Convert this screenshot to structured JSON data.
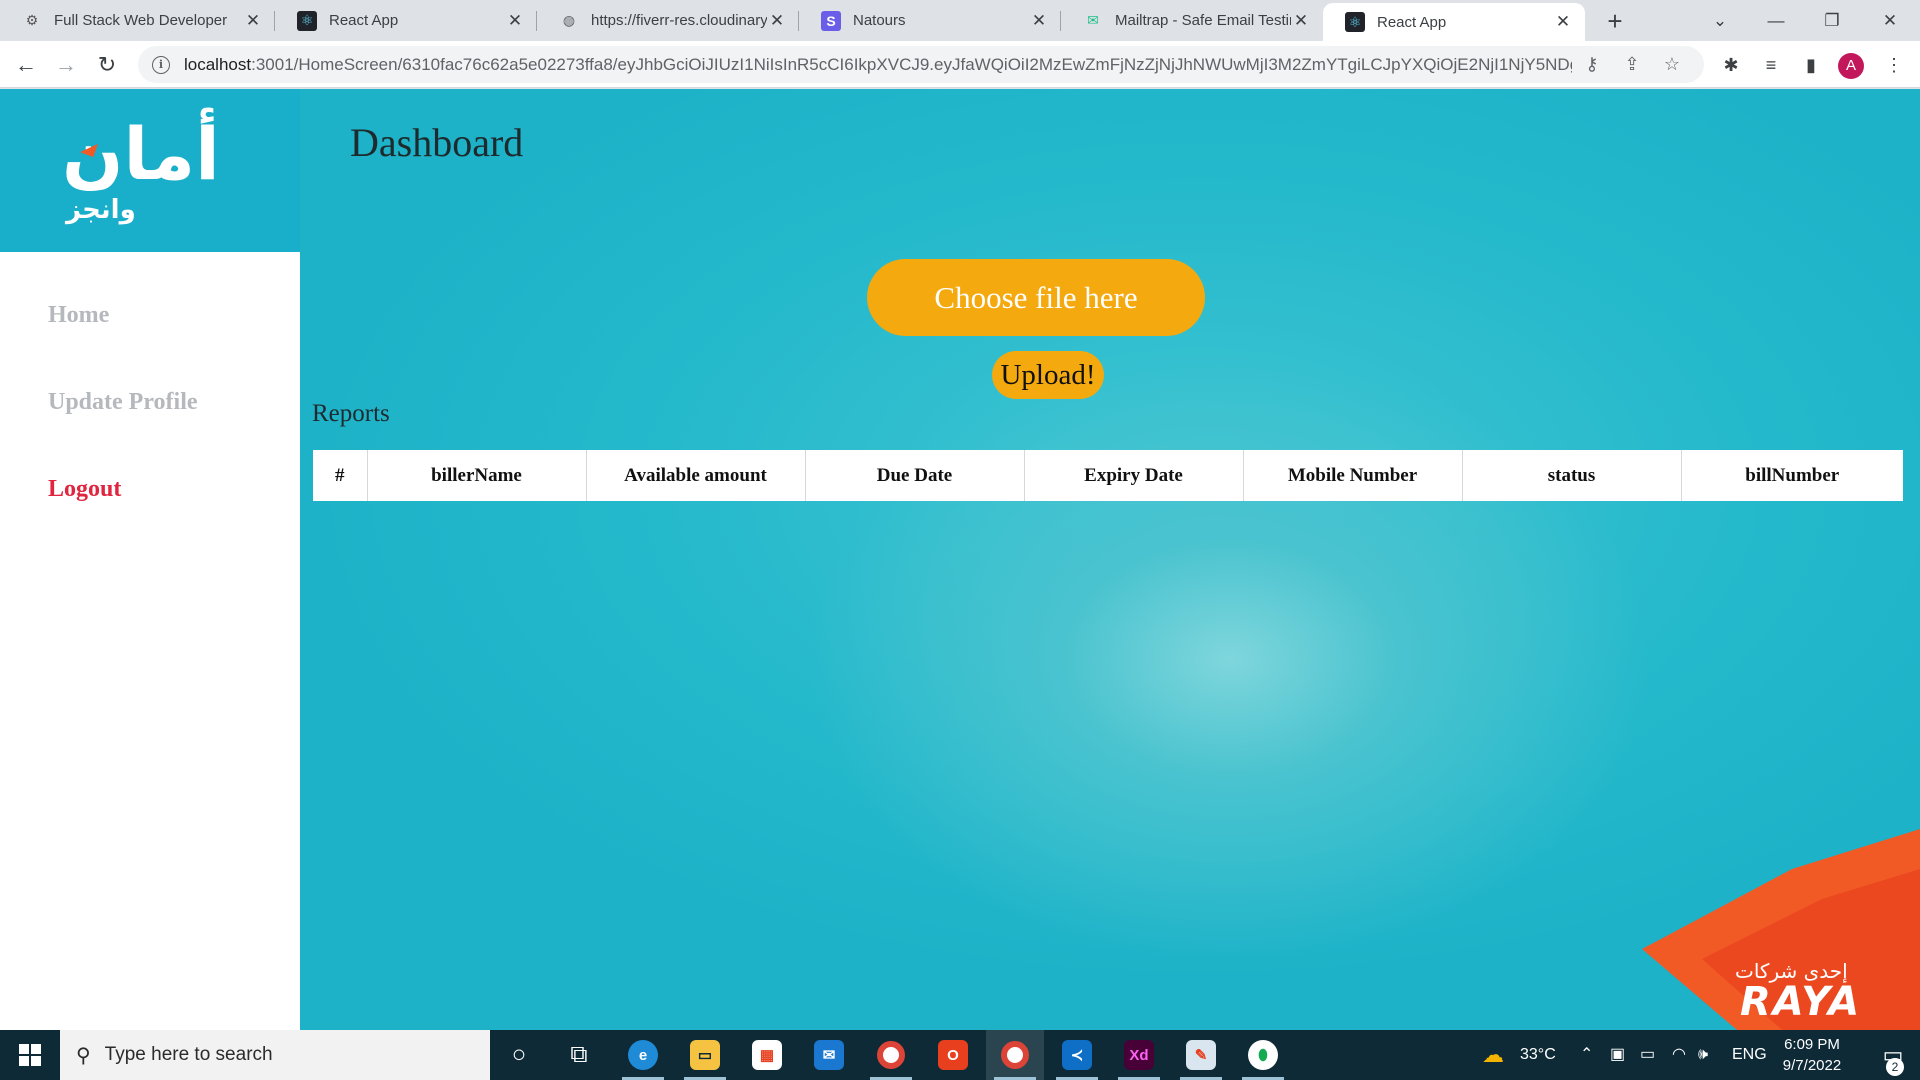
{
  "browser": {
    "tabs": [
      {
        "title": "Full Stack Web Developer",
        "icon": "fiverr-icon"
      },
      {
        "title": "React App",
        "icon": "react-icon"
      },
      {
        "title": "https://fiverr-res.cloudinary",
        "icon": "globe-icon"
      },
      {
        "title": "Natours",
        "icon": "natours-s-icon"
      },
      {
        "title": "Mailtrap - Safe Email Testin",
        "icon": "mailtrap-icon"
      },
      {
        "title": "React App",
        "icon": "react-icon"
      }
    ],
    "active_tab_index": 5,
    "url_host": "localhost",
    "url_path": ":3001/HomeScreen/6310fac76c62a5e02273ffa8/eyJhbGciOiJIUzI1NiIsInR5cCI6IkpXVCJ9.eyJfaWQiOiI2MzEwZmFjNzZjNjJhNWUwMjI3M2ZmYTgiLCJpYXQiOjE2NjI1NjY5NDgs...",
    "profile_initial": "A"
  },
  "app": {
    "logo_main": "أمان",
    "logo_sub": "وانجز",
    "nav": {
      "home": "Home",
      "update_profile": "Update Profile",
      "logout": "Logout"
    },
    "page_title": "Dashboard",
    "choose_file_label": "Choose file here",
    "upload_label": "Upload!",
    "reports_label": "Reports",
    "table_headers": [
      "#",
      "billerName",
      "Available amount",
      "Due Date",
      "Expiry Date",
      "Mobile Number",
      "status",
      "billNumber"
    ],
    "table_rows": [],
    "brand_sub": "إحدى شركات",
    "brand_main": "RAYA",
    "colors": {
      "accent_button": "#f4a90f",
      "sidebar_logo_bg": "#19aec9",
      "logout_red": "#e0253f",
      "page_bg": "#1fb4c9",
      "brand_orange": "#f15a24"
    }
  },
  "taskbar": {
    "search_placeholder": "Type here to search",
    "weather": "33°C",
    "language": "ENG",
    "time": "6:09 PM",
    "date": "9/7/2022",
    "notification_count": "2",
    "apps": [
      "cortana-icon",
      "task-view-icon",
      "edge-icon",
      "file-explorer-icon",
      "store-icon",
      "mail-icon",
      "chrome-icon",
      "office-icon",
      "chrome-profile-icon",
      "vscode-icon",
      "adobe-xd-icon",
      "paint-icon",
      "mongodb-compass-icon"
    ]
  }
}
